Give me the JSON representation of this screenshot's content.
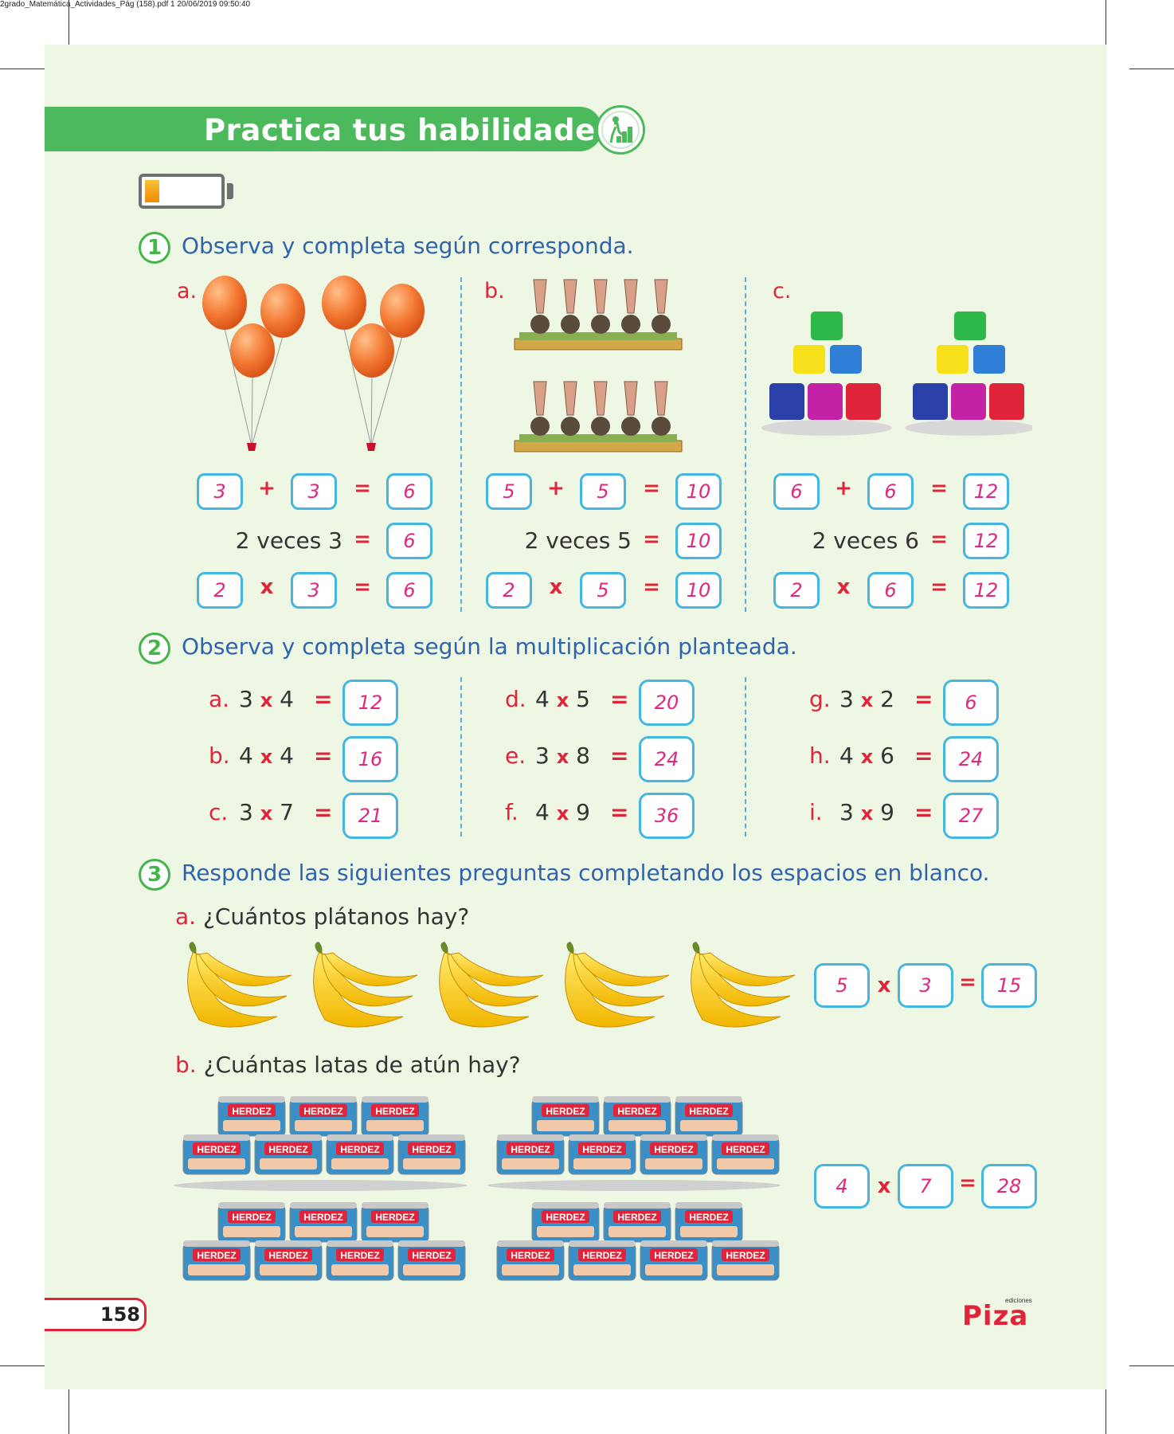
{
  "file_header": "2grado_Matemática_Actividades_Pág (158).pdf   1   20/06/2019   09:50:40",
  "banner_title": "Practica tus habilidades",
  "battery_level": 0.2,
  "colors": {
    "green": "#4cb95c",
    "blue_text": "#2f64ad",
    "red": "#e0243a",
    "box_border": "#45b6e0",
    "answer": "#e0287e",
    "page_bg": "#eef7e4"
  },
  "ex1": {
    "number": "1",
    "instruction": "Observa y completa según corresponda.",
    "parts": [
      {
        "letter": "a.",
        "add": [
          "3",
          "+",
          "3",
          "=",
          "6"
        ],
        "veces": "2 veces 3",
        "veces_eq": "=",
        "veces_ans": "6",
        "mul": [
          "2",
          "x",
          "3",
          "=",
          "6"
        ]
      },
      {
        "letter": "b.",
        "add": [
          "5",
          "+",
          "5",
          "=",
          "10"
        ],
        "veces": "2 veces 5",
        "veces_eq": "=",
        "veces_ans": "10",
        "mul": [
          "2",
          "x",
          "5",
          "=",
          "10"
        ]
      },
      {
        "letter": "c.",
        "add": [
          "6",
          "+",
          "6",
          "=",
          "12"
        ],
        "veces": "2 veces 6",
        "veces_eq": "=",
        "veces_ans": "12",
        "mul": [
          "2",
          "x",
          "6",
          "=",
          "12"
        ]
      }
    ]
  },
  "ex2": {
    "number": "2",
    "instruction": "Observa y completa según la multiplicación planteada.",
    "items": [
      {
        "letter": "a.",
        "a": "3",
        "x": "x",
        "b": "4",
        "eq": "=",
        "ans": "12"
      },
      {
        "letter": "b.",
        "a": "4",
        "x": "x",
        "b": "4",
        "eq": "=",
        "ans": "16"
      },
      {
        "letter": "c.",
        "a": "3",
        "x": "x",
        "b": "7",
        "eq": "=",
        "ans": "21"
      },
      {
        "letter": "d.",
        "a": "4",
        "x": "x",
        "b": "5",
        "eq": "=",
        "ans": "20"
      },
      {
        "letter": "e.",
        "a": "3",
        "x": "x",
        "b": "8",
        "eq": "=",
        "ans": "24"
      },
      {
        "letter": "f.",
        "a": "4",
        "x": "x",
        "b": "9",
        "eq": "=",
        "ans": "36"
      },
      {
        "letter": "g.",
        "a": "3",
        "x": "x",
        "b": "2",
        "eq": "=",
        "ans": "6"
      },
      {
        "letter": "h.",
        "a": "4",
        "x": "x",
        "b": "6",
        "eq": "=",
        "ans": "24"
      },
      {
        "letter": "i.",
        "a": "3",
        "x": "x",
        "b": "9",
        "eq": "=",
        "ans": "27"
      }
    ]
  },
  "ex3": {
    "number": "3",
    "instruction": "Responde las siguientes preguntas completando los espacios en blanco.",
    "qa": {
      "letter": "a.",
      "text": "¿Cuántos plátanos hay?",
      "eq": [
        "5",
        "x",
        "3",
        "=",
        "15"
      ]
    },
    "qb": {
      "letter": "b.",
      "text": "¿Cuántas latas de atún hay?",
      "eq": [
        "4",
        "x",
        "7",
        "=",
        "28"
      ]
    },
    "can_label": "HERDEZ"
  },
  "page_number": "158",
  "logo": {
    "brand": "Piza",
    "small": "ediciones"
  }
}
